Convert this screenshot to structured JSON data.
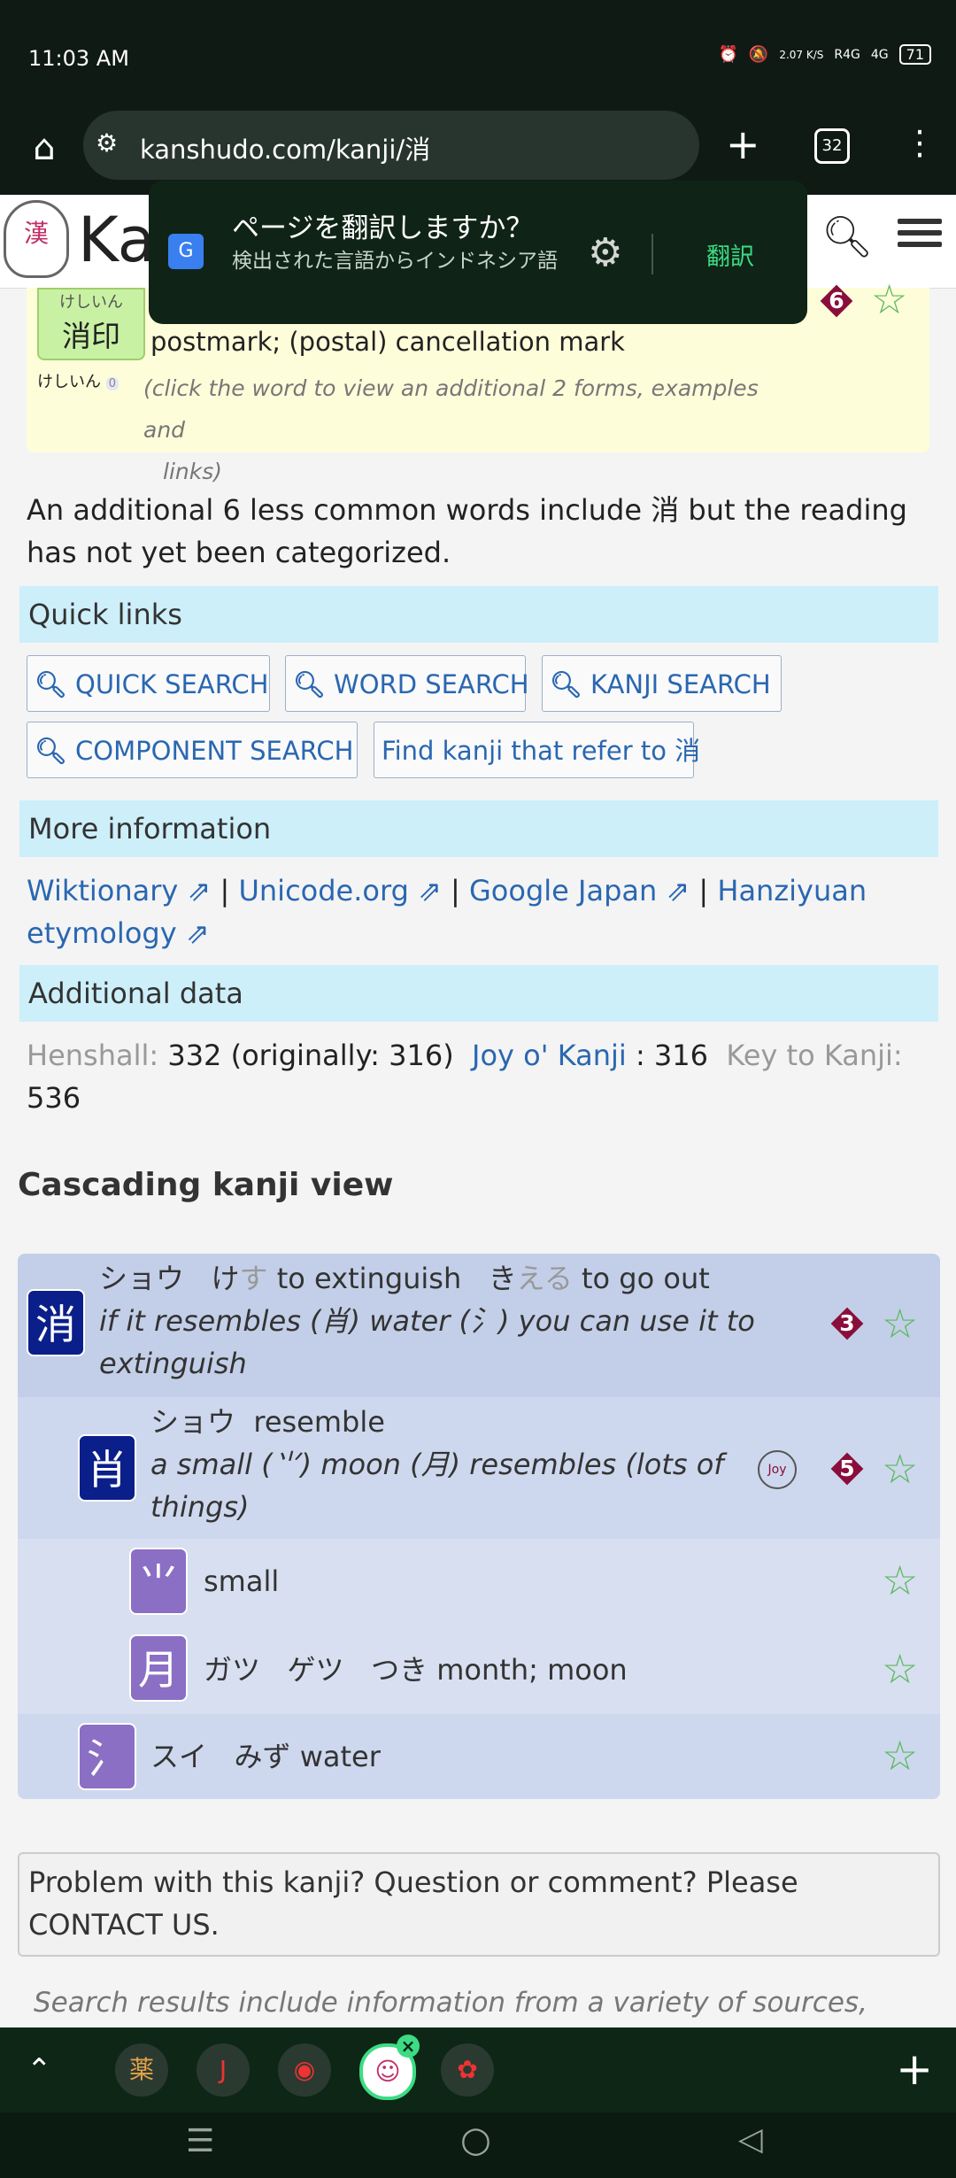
{
  "status": {
    "time": "11:03 AM",
    "speed": "2.07 K/S",
    "signal1": "R4G",
    "signal2": "4G",
    "battery": "71"
  },
  "browser": {
    "url": "kanshudo.com/kanji/消",
    "tab_count": "32"
  },
  "site": {
    "logo_char": "漢",
    "brand": "Ka"
  },
  "translate_popup": {
    "title": "ページを翻訳しますか？",
    "subtitle": "検出された言語からインドネシア語",
    "action": "翻訳"
  },
  "word_entry": {
    "ruby": "けしいん",
    "word": "消印",
    "meaning": "postmark; (postal) cancellation mark",
    "mini_reading": "けしいん",
    "mini_badge": "0",
    "click_note_1": "(click the word to view an additional 2 forms, examples and",
    "click_note_2": "links)",
    "rank": "6"
  },
  "additional_words": "An additional 6 less common words include 消 but the reading has not yet been categorized.",
  "quick_links": {
    "title": "Quick links",
    "buttons": [
      "QUICK SEARCH",
      "WORD SEARCH",
      "KANJI SEARCH",
      "COMPONENT SEARCH"
    ],
    "refer": "Find kanji that refer to 消"
  },
  "more_info": {
    "title": "More information",
    "links": [
      "Wiktionary ⇗",
      "Unicode.org ⇗",
      "Google Japan ⇗",
      "Hanziyuan etymology ⇗"
    ],
    "sep": "|"
  },
  "additional_data": {
    "title": "Additional data",
    "henshall_label": "Henshall:",
    "henshall_value": "332 (originally: 316)",
    "joyo_label": "Joy o' Kanji",
    "joyo_value": ": 316",
    "key_label": "Key to Kanji:",
    "key_value": "536"
  },
  "cascade": {
    "title": "Cascading kanji view",
    "rows": [
      {
        "kanji": "消",
        "on": "ショウ",
        "kun_a": "け",
        "kun_b": "す",
        "kun_gloss": "to extinguish",
        "kun2_a": "き",
        "kun2_b": "える",
        "kun2_gloss": "to go out",
        "mnemonic": "if it resembles (肖) water (氵) you can use it to extinguish",
        "rank": "3",
        "box_color": "#0b1f8a"
      },
      {
        "kanji": "肖",
        "on": "ショウ",
        "gloss": "resemble",
        "mnemonic": "a small (⺌) moon (月) resembles (lots of things)",
        "rank": "5",
        "box_color": "#0b1f8a"
      },
      {
        "kanji": "⺌",
        "gloss": "small",
        "box_color": "#8b6fc4"
      },
      {
        "kanji": "月",
        "on1": "ガツ",
        "on2": "ゲツ",
        "kun": "つき",
        "gloss": "month; moon",
        "box_color": "#8b6fc4"
      },
      {
        "kanji": "氵",
        "on": "スイ",
        "kun": "みず",
        "gloss": "water",
        "box_color": "#8b6fc4"
      }
    ]
  },
  "problem": "Problem with this kanji? Question or comment? Please CONTACT US.",
  "footnote": "Search results include information from a variety of sources,",
  "bottom_tabs": [
    "薬",
    "J",
    "◉",
    "☺",
    "✿"
  ]
}
